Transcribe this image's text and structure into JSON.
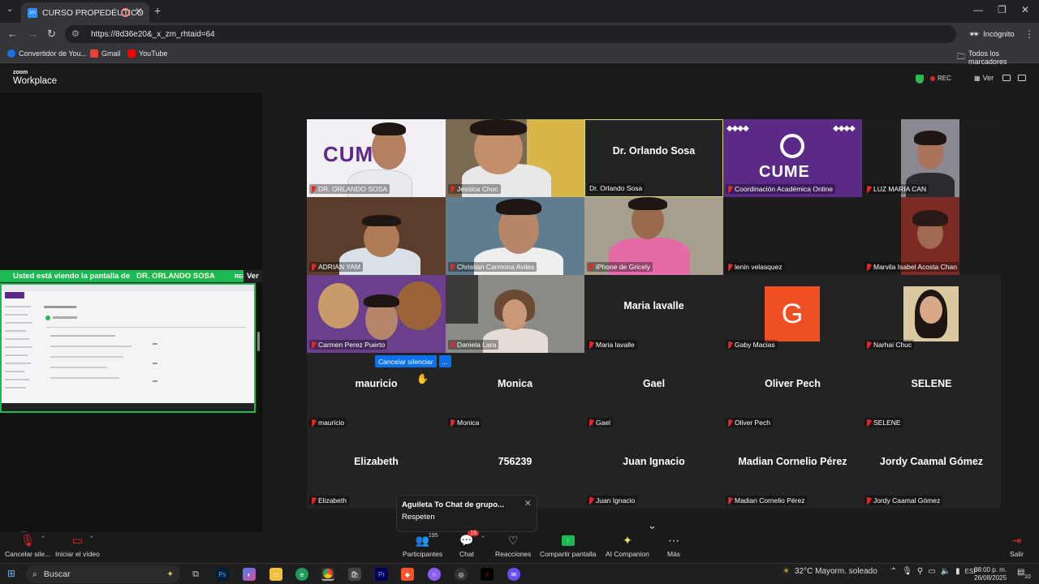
{
  "browser": {
    "tab_title": "CURSO PROPEDÉUTICO",
    "tab_favicon_text": "zm",
    "url": "https://8d36e20&_x_zm_rhtaid=64",
    "incognito_label": "Incógnito",
    "bookmarks": [
      {
        "label": "Convertidor de You...",
        "color": "#1a73e8"
      },
      {
        "label": "Gmail",
        "color": "#ea4335"
      },
      {
        "label": "YouTube",
        "color": "#ff0000"
      }
    ],
    "all_bookmarks_label": "Todos los marcadores"
  },
  "zoom": {
    "logo_top": "zoom",
    "logo_bottom": "Workplace",
    "rec_label": "REC",
    "view_label": "Ver",
    "share_banner": {
      "prefix": "Usted está viendo la pantalla de",
      "name": "DR. ORLANDO SOSA",
      "rec": "REC",
      "ver": "Ver"
    },
    "tiles": [
      {
        "big": "",
        "label": "DR. ORLANDO SOSA",
        "kind": "cume-man"
      },
      {
        "big": "",
        "label": "Jessica Choc",
        "kind": "photo"
      },
      {
        "big": "Dr. Orlando Sosa",
        "label": "Dr. Orlando Sosa",
        "kind": "name"
      },
      {
        "big": "",
        "label": "Coordinación Académica Online",
        "kind": "cume"
      },
      {
        "big": "",
        "label": "LUZ MARIA CAN",
        "kind": "portrait"
      },
      {
        "big": "",
        "label": "ADRIAN YAM",
        "kind": "photo"
      },
      {
        "big": "",
        "label": "Christian Carmona Aviles",
        "kind": "photo"
      },
      {
        "big": "",
        "label": "iPhone de Gricely",
        "kind": "photo"
      },
      {
        "big": "",
        "label": "lenin velasquez",
        "kind": "blank"
      },
      {
        "big": "",
        "label": "Marvila Isabel Acosta Chan",
        "kind": "portrait"
      },
      {
        "big": "",
        "label": "Carmen Perez Puerto",
        "kind": "photo"
      },
      {
        "big": "",
        "label": "Daniela Lara",
        "kind": "photo"
      },
      {
        "big": "Maria lavalle",
        "label": "Maria lavalle",
        "kind": "name"
      },
      {
        "big": "G",
        "label": "Gaby Macias",
        "kind": "avatar"
      },
      {
        "big": "",
        "label": "Narhai Chuc",
        "kind": "portrait"
      },
      {
        "big": "mauricio",
        "label": "mauricio",
        "kind": "name"
      },
      {
        "big": "Monica",
        "label": "Monica",
        "kind": "name"
      },
      {
        "big": "Gael",
        "label": "Gael",
        "kind": "name"
      },
      {
        "big": "Oliver Pech",
        "label": "Oliver Pech",
        "kind": "name"
      },
      {
        "big": "SELENE",
        "label": "SELENE",
        "kind": "name"
      },
      {
        "big": "Elizabeth",
        "label": "Elizabeth",
        "kind": "name"
      },
      {
        "big": "756239",
        "label": "756239",
        "kind": "name"
      },
      {
        "big": "Juan Ignacio",
        "label": "Juan Ignacio",
        "kind": "name"
      },
      {
        "big": "Madian Cornelio Pérez",
        "label": "Madian Cornelio Pérez",
        "kind": "name"
      },
      {
        "big": "Jordy Caamal Gómez",
        "label": "Jordy Caamal Gómez",
        "kind": "name"
      }
    ],
    "cume_text": "CUME",
    "unmute_popup": {
      "label": "Cancelar silenciar",
      "more": "..."
    },
    "chat_toast": {
      "title": "Aguileta To Chat de grupo...",
      "message": "Respeten"
    },
    "toolbar": {
      "mute": "Cancelar sile...",
      "video": "Iniciar el vídeo",
      "participants": "Participantes",
      "participants_count": "195",
      "chat": "Chat",
      "chat_badge": "15",
      "reactions": "Reacciones",
      "share": "Compartir pantalla",
      "ai": "AI Companion",
      "more": "Más",
      "leave": "Salir"
    }
  },
  "taskbar": {
    "search": "Buscar",
    "weather": "32°C  Mayorm. soleado",
    "lang": "ESP",
    "time": "08:00 p. m.",
    "date": "26/08/2025",
    "notif": "10"
  }
}
